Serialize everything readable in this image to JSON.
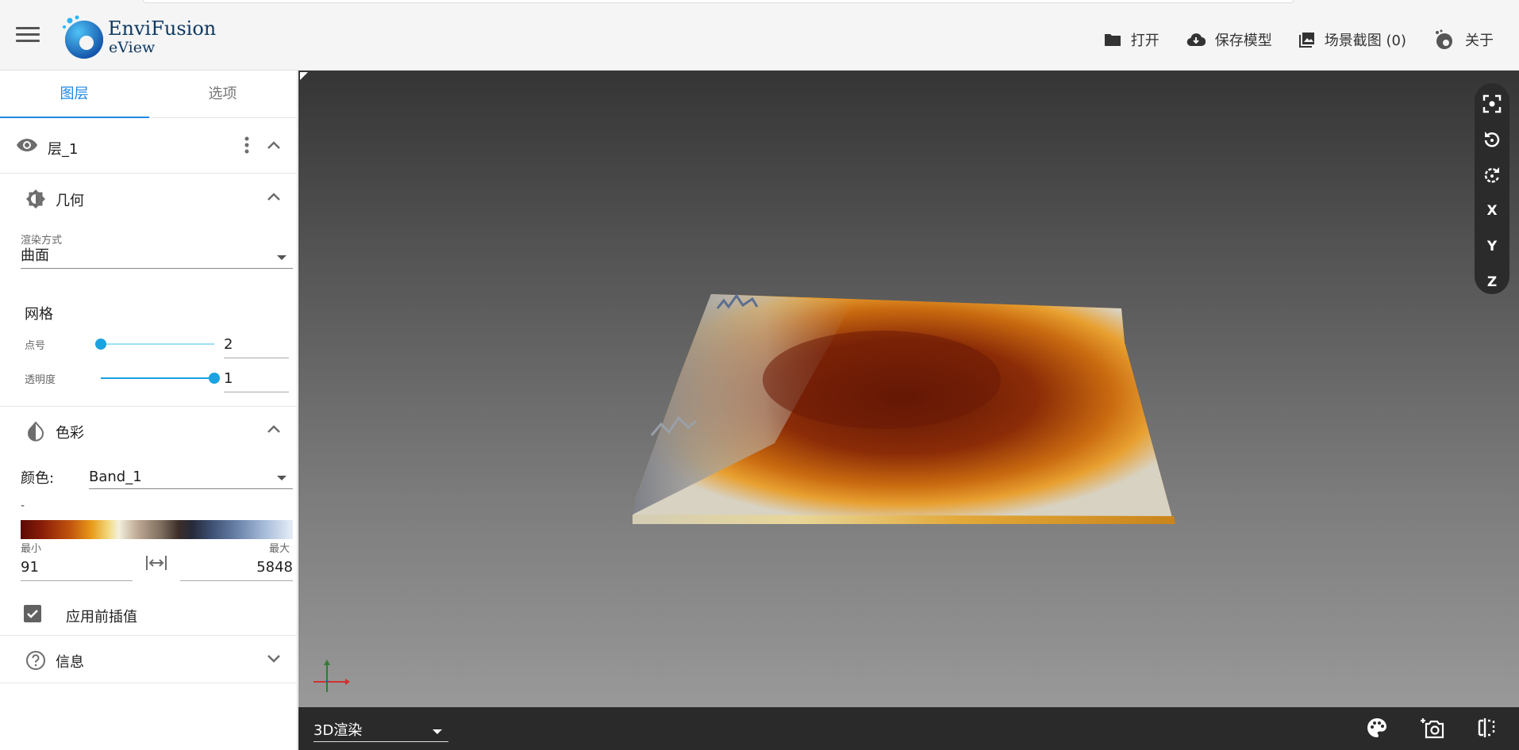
{
  "header": {
    "brand_line1": "EnviFusion",
    "brand_line2": "eView",
    "actions": {
      "open": "打开",
      "save": "保存模型",
      "screenshot": "场景截图 (0)",
      "about": "关于"
    }
  },
  "sidebar": {
    "tabs": [
      "图层",
      "选项"
    ],
    "active_tab": "图层",
    "layer": {
      "name": "层_1",
      "visible": true
    },
    "geometry": {
      "title": "几何",
      "render_mode_label": "渲染方式",
      "render_mode_value": "曲面",
      "grid_title": "网格",
      "point_size_label": "点号",
      "point_size_value": "2",
      "point_size_fraction": 0.0,
      "opacity_label": "透明度",
      "opacity_value": "1",
      "opacity_fraction": 1.0
    },
    "color": {
      "title": "色彩",
      "color_label": "颜色:",
      "band_value": "Band_1",
      "unit_label": "-",
      "min_label": "最小",
      "max_label": "最大",
      "min_value": "91",
      "max_value": "5848",
      "apply_interp_label": "应用前插值",
      "apply_interp_checked": true
    },
    "info": {
      "title": "信息"
    }
  },
  "viewport": {
    "toolbar": [
      "X",
      "Y",
      "Z"
    ],
    "render_mode": "3D渲染"
  },
  "colors": {
    "accent": "#1e88e5",
    "slider": "#1aa3e0",
    "brand": "#0f3a63"
  }
}
